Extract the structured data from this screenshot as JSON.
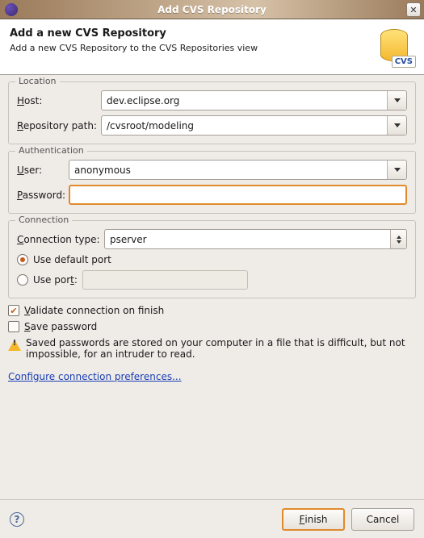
{
  "window": {
    "title": "Add CVS Repository"
  },
  "header": {
    "title": "Add a new CVS Repository",
    "subtitle": "Add a new CVS Repository to the CVS Repositories view",
    "badge": "CVS"
  },
  "location": {
    "legend": "Location",
    "host_label": "Host:",
    "host_value": "dev.eclipse.org",
    "path_label": "Repository path:",
    "path_value": "/cvsroot/modeling"
  },
  "auth": {
    "legend": "Authentication",
    "user_label": "User:",
    "user_value": "anonymous",
    "password_label": "Password:",
    "password_value": ""
  },
  "connection": {
    "legend": "Connection",
    "type_label": "Connection type:",
    "type_value": "pserver",
    "default_port_label": "Use default port",
    "use_port_label": "Use port:"
  },
  "options": {
    "validate_label": "Validate connection on finish",
    "validate_checked": true,
    "save_pw_label": "Save password",
    "save_pw_checked": false,
    "warning_text": "Saved passwords are stored on your computer in a file that is difficult, but not impossible, for an intruder to read."
  },
  "links": {
    "configure": "Configure connection preferences..."
  },
  "footer": {
    "finish": "Finish",
    "cancel": "Cancel"
  }
}
